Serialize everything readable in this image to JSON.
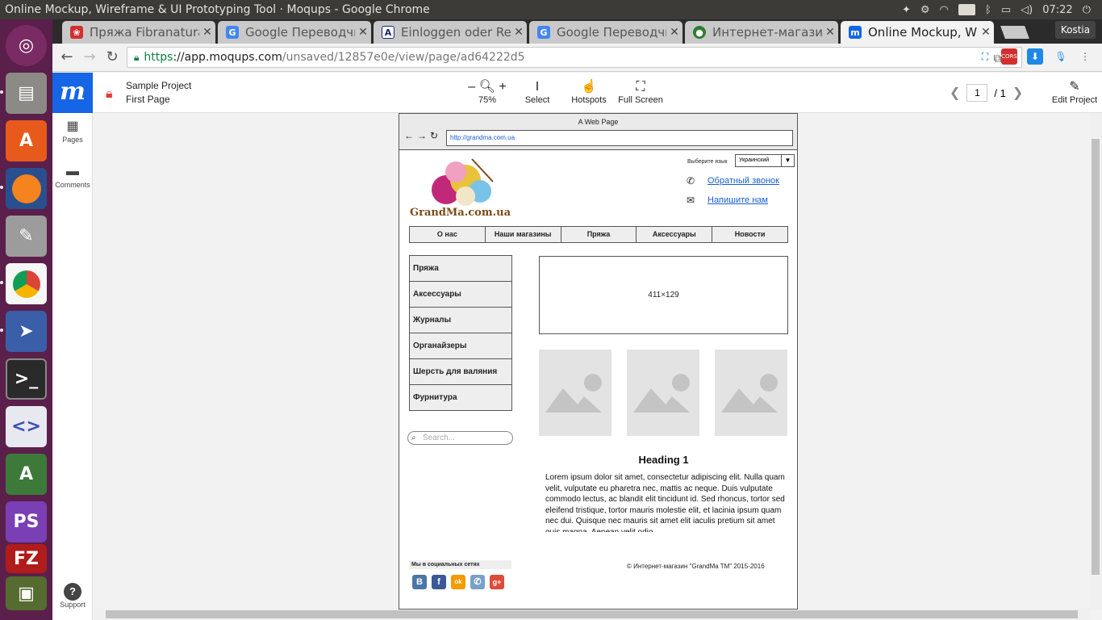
{
  "os": {
    "window_title": "Online Mockup, Wireframe & UI Prototyping Tool · Moqups - Google Chrome",
    "keyboard_layout": "En",
    "clock": "07:22",
    "user": "Kostia"
  },
  "tabs": [
    {
      "label": "Пряжа Fibranatura",
      "color": "#d32f2f"
    },
    {
      "label": "Google Переводчи",
      "color": "#4285f4"
    },
    {
      "label": "Einloggen oder Reg",
      "color": "#1a237e"
    },
    {
      "label": "Google Переводчи",
      "color": "#4285f4"
    },
    {
      "label": "Интернет-магазин",
      "color": "#2e7d32"
    },
    {
      "label": "Online Mockup, Wi",
      "color": "#1565e6"
    }
  ],
  "omnibox": {
    "scheme": "https",
    "host": "://app.moqups.com",
    "path": "/unsaved/12857e0e/view/page/ad64222d5"
  },
  "moqups": {
    "logo": "m",
    "project_name": "Sample Project",
    "page_name": "First Page",
    "zoom": "75%",
    "zoom_minus": "–",
    "zoom_plus": "+",
    "tools": {
      "select": "Select",
      "hotspots": "Hotspots",
      "fullscreen": "Full Screen"
    },
    "page_current": "1",
    "page_total": "/ 1",
    "edit": "Edit Project",
    "sidebar": {
      "pages": "Pages",
      "comments": "Comments",
      "support": "Support"
    }
  },
  "wireframe": {
    "window_title": "A Web Page",
    "url": "http://grandma.com.ua",
    "logo_text": "GrandMa.com.ua",
    "lang_label": "Выберите язык",
    "lang_value": "Украинский",
    "callback": "Обратный звонок",
    "write_us": "Напишите нам",
    "menu": [
      "О нас",
      "Наши магазины",
      "Пряжа",
      "Аксессуары",
      "Новости"
    ],
    "categories": [
      "Пряжа",
      "Аксессуары",
      "Журналы",
      "Органайзеры",
      "Шерсть для валяния",
      "Фурнитура"
    ],
    "search_placeholder": "Search...",
    "banner": "411×129",
    "heading": "Heading 1",
    "body": "Lorem ipsum dolor sit amet, consectetur adipiscing elit. Nulla quam velit, vulputate eu pharetra nec, mattis ac neque. Duis vulputate commodo lectus, ac blandit elit tincidunt id. Sed rhoncus, tortor sed eleifend tristique, tortor mauris molestie elit, et lacinia ipsum quam nec dui. Quisque nec mauris sit amet elit iaculis pretium sit amet quis magna. Aenean velit odio,",
    "social_label": "Мы в социальных сетях",
    "social": [
      {
        "glyph": "В",
        "color": "#4a76a8"
      },
      {
        "glyph": "f",
        "color": "#3b5998"
      },
      {
        "glyph": "ok",
        "color": "#f59a00"
      },
      {
        "glyph": "✆",
        "color": "#7aa0c8"
      },
      {
        "glyph": "g+",
        "color": "#dd4b39"
      }
    ],
    "copyright": "© Интернет-магазин \"GrandMa TM\" 2015-2016"
  }
}
